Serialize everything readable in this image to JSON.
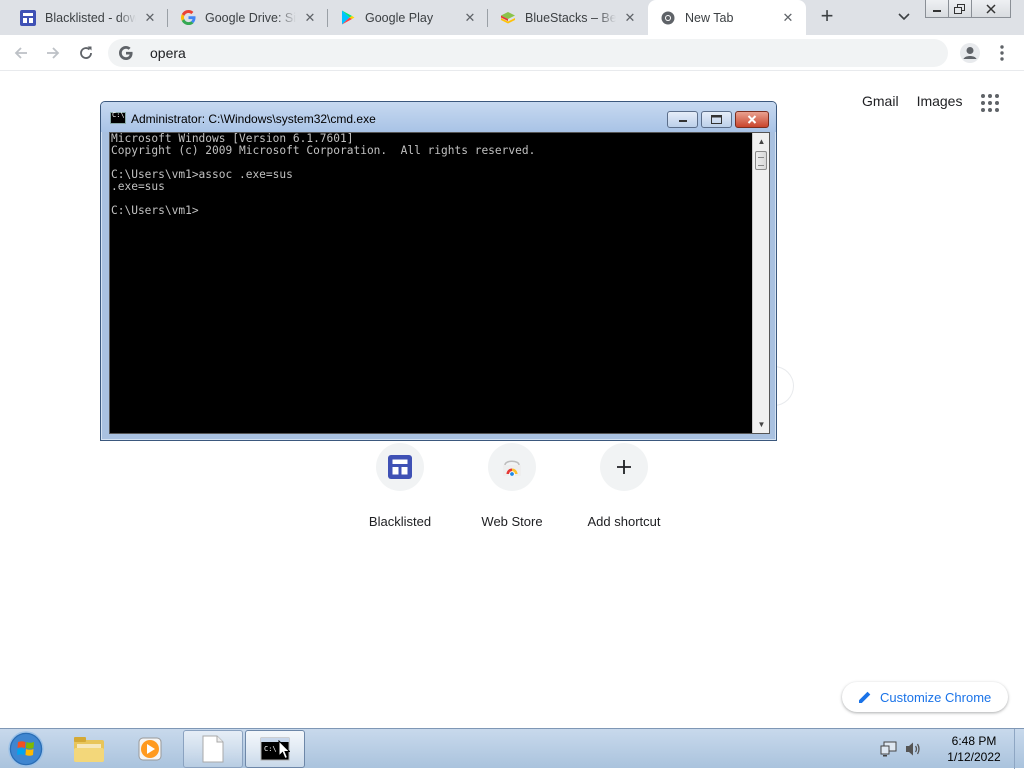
{
  "browser": {
    "tabs": [
      {
        "title": "Blacklisted - dow",
        "favicon": "blacklisted-favicon-icon"
      },
      {
        "title": "Google Drive: Sig",
        "favicon": "google-g-icon"
      },
      {
        "title": "Google Play",
        "favicon": "google-play-icon"
      },
      {
        "title": "BlueStacks – Best",
        "favicon": "bluestacks-icon"
      },
      {
        "title": "New Tab",
        "favicon": "chrome-icon"
      }
    ],
    "omnibox_value": "opera",
    "header_links": {
      "gmail": "Gmail",
      "images": "Images"
    },
    "shortcuts": [
      {
        "label": "Blacklisted",
        "icon": "blacklisted-favicon-icon"
      },
      {
        "label": "Web Store",
        "icon": "web-store-icon"
      },
      {
        "label": "Add shortcut",
        "icon": "plus-icon"
      }
    ],
    "customize_label": "Customize Chrome"
  },
  "cmd": {
    "title": "Administrator: C:\\Windows\\system32\\cmd.exe",
    "output": "Microsoft Windows [Version 6.1.7601]\nCopyright (c) 2009 Microsoft Corporation.  All rights reserved.\n\nC:\\Users\\vm1>assoc .exe=sus\n.exe=sus\n\nC:\\Users\\vm1>"
  },
  "taskbar": {
    "clock_time": "6:48 PM",
    "clock_date": "1/12/2022"
  },
  "colors": {
    "accent": "#1a73e8",
    "tabstrip": "#dee1e6",
    "taskbar": "#b9cde4"
  }
}
